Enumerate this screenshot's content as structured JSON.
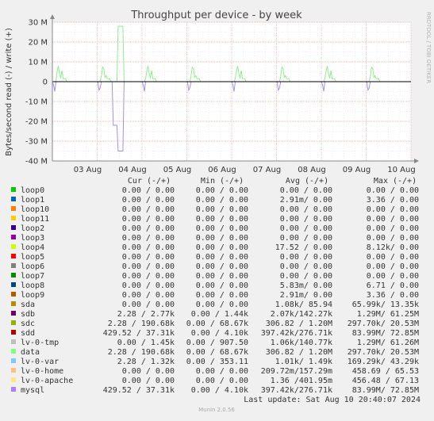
{
  "chart_data": {
    "type": "line",
    "title": "Throughput per device - by week",
    "ylabel": "Bytes/second read (-) / write (+)",
    "ylim": [
      -40000000,
      30000000
    ],
    "y_ticks": [
      {
        "value": 30000000,
        "label": "30 M"
      },
      {
        "value": 20000000,
        "label": "20 M"
      },
      {
        "value": 10000000,
        "label": "10 M"
      },
      {
        "value": 0,
        "label": "0"
      },
      {
        "value": -10000000,
        "label": "-10 M"
      },
      {
        "value": -20000000,
        "label": "-20 M"
      },
      {
        "value": -30000000,
        "label": "-30 M"
      },
      {
        "value": -40000000,
        "label": "-40 M"
      }
    ],
    "x_ticks": [
      "03 Aug",
      "04 Aug",
      "05 Aug",
      "06 Aug",
      "07 Aug",
      "08 Aug",
      "09 Aug",
      "10 Aug"
    ],
    "grid": true,
    "series_notes": [
      {
        "name": "sdc",
        "color": "#7bd36f",
        "write_peak": 20530000,
        "read_peak": 297700
      },
      {
        "name": "sdd",
        "color": "#7d2a6f",
        "write_peak": 72850000,
        "read_peak": 83990000
      },
      {
        "name": "data",
        "color": "#90ee90",
        "write_peak": 20530000,
        "read_peak": 297700
      },
      {
        "name": "mysql",
        "color": "#a58fe8",
        "write_peak": 72850000,
        "read_peak": 83990000
      }
    ]
  },
  "watermark": "RRDTOOL / TOBI OETIKER",
  "legend": {
    "headers": {
      "cur": "Cur (-/+)",
      "min": "Min (-/+)",
      "avg": "Avg (-/+)",
      "max": "Max (-/+)"
    },
    "rows": [
      {
        "name": "loop0",
        "color": "#00cc00",
        "cur": "0.00 /   0.00",
        "min": "0.00 /   0.00",
        "avg": "0.00 /   0.00",
        "max": "0.00 /   0.00"
      },
      {
        "name": "loop1",
        "color": "#0066b3",
        "cur": "0.00 /   0.00",
        "min": "0.00 /   0.00",
        "avg": "2.91m/   0.00",
        "max": "3.36 /   0.00"
      },
      {
        "name": "loop10",
        "color": "#ff8000",
        "cur": "0.00 /   0.00",
        "min": "0.00 /   0.00",
        "avg": "0.00 /   0.00",
        "max": "0.00 /   0.00"
      },
      {
        "name": "loop11",
        "color": "#ffcc00",
        "cur": "0.00 /   0.00",
        "min": "0.00 /   0.00",
        "avg": "0.00 /   0.00",
        "max": "0.00 /   0.00"
      },
      {
        "name": "loop2",
        "color": "#330099",
        "cur": "0.00 /   0.00",
        "min": "0.00 /   0.00",
        "avg": "0.00 /   0.00",
        "max": "0.00 /   0.00"
      },
      {
        "name": "loop3",
        "color": "#990099",
        "cur": "0.00 /   0.00",
        "min": "0.00 /   0.00",
        "avg": "0.00 /   0.00",
        "max": "0.00 /   0.00"
      },
      {
        "name": "loop4",
        "color": "#ccff00",
        "cur": "0.00 /   0.00",
        "min": "0.00 /   0.00",
        "avg": "17.52 /   0.00",
        "max": "8.12k/   0.00"
      },
      {
        "name": "loop5",
        "color": "#ff0000",
        "cur": "0.00 /   0.00",
        "min": "0.00 /   0.00",
        "avg": "0.00 /   0.00",
        "max": "0.00 /   0.00"
      },
      {
        "name": "loop6",
        "color": "#808080",
        "cur": "0.00 /   0.00",
        "min": "0.00 /   0.00",
        "avg": "0.00 /   0.00",
        "max": "0.00 /   0.00"
      },
      {
        "name": "loop7",
        "color": "#008f00",
        "cur": "0.00 /   0.00",
        "min": "0.00 /   0.00",
        "avg": "0.00 /   0.00",
        "max": "0.00 /   0.00"
      },
      {
        "name": "loop8",
        "color": "#00487d",
        "cur": "0.00 /   0.00",
        "min": "0.00 /   0.00",
        "avg": "5.83m/   0.00",
        "max": "6.71 /   0.00"
      },
      {
        "name": "loop9",
        "color": "#b35a00",
        "cur": "0.00 /   0.00",
        "min": "0.00 /   0.00",
        "avg": "2.91m/   0.00",
        "max": "3.36 /   0.00"
      },
      {
        "name": "sda",
        "color": "#b38f00",
        "cur": "0.00 /   0.00",
        "min": "0.00 /   0.00",
        "avg": "1.08k/ 85.94",
        "max": "65.99k/ 13.35k"
      },
      {
        "name": "sdb",
        "color": "#6b006b",
        "cur": "2.28 /   2.77k",
        "min": "0.00 /   1.44k",
        "avg": "2.07k/142.27k",
        "max": "1.29M/ 61.25M"
      },
      {
        "name": "sdc",
        "color": "#8fb300",
        "cur": "2.28 / 190.68k",
        "min": "0.00 /  68.67k",
        "avg": "306.82 /   1.20M",
        "max": "297.70k/ 20.53M"
      },
      {
        "name": "sdd",
        "color": "#b30000",
        "cur": "429.52 /  37.31k",
        "min": "0.00 /   4.10k",
        "avg": "397.42k/276.71k",
        "max": "83.99M/ 72.85M"
      },
      {
        "name": "lv-0-tmp",
        "color": "#bebebe",
        "cur": "0.00 /   1.45k",
        "min": "0.00 / 907.50",
        "avg": "1.06k/140.77k",
        "max": "1.29M/ 61.26M"
      },
      {
        "name": "data",
        "color": "#80ff80",
        "cur": "2.28 / 190.68k",
        "min": "0.00 /  68.67k",
        "avg": "306.82 /   1.20M",
        "max": "297.70k/ 20.53M"
      },
      {
        "name": "lv-0-var",
        "color": "#80c9ff",
        "cur": "2.28 /   1.32k",
        "min": "0.00 / 353.11",
        "avg": "1.01k/   1.49k",
        "max": "169.29k/ 43.29k"
      },
      {
        "name": "lv-0-home",
        "color": "#ffc080",
        "cur": "0.00 /   0.00",
        "min": "0.00 /   0.00",
        "avg": "209.72m/157.29m",
        "max": "458.69 / 65.53"
      },
      {
        "name": "lv-0-apache",
        "color": "#ffe680",
        "cur": "0.00 /   0.00",
        "min": "0.00 /   0.00",
        "avg": "1.36 /401.95m",
        "max": "456.48 / 67.13"
      },
      {
        "name": "mysql",
        "color": "#aa80ff",
        "cur": "429.52 /  37.31k",
        "min": "0.00 /   4.10k",
        "avg": "397.42k/276.71k",
        "max": "83.99M/ 72.85M"
      }
    ]
  },
  "last_update": "Last update: Sat Aug 10 20:40:07 2024",
  "footer": "Munin 2.0.56"
}
